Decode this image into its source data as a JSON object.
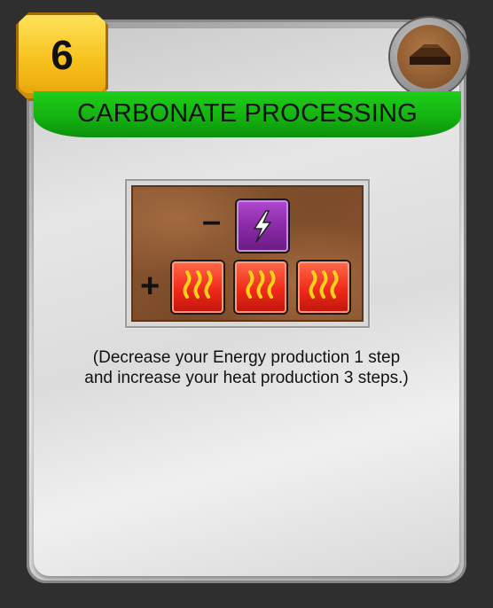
{
  "card": {
    "cost": "6",
    "title": "CARBONATE PROCESSING",
    "tag_icon": "building-tag-icon",
    "description_line1": "(Decrease your Energy production 1 step",
    "description_line2": "and increase your heat production 3 steps.)"
  },
  "production_box": {
    "decrease_sign": "–",
    "increase_sign": "+",
    "decrease": [
      {
        "resource": "energy",
        "icon": "energy-bolt-icon",
        "count": 1
      }
    ],
    "increase": [
      {
        "resource": "heat",
        "icon": "heat-waves-icon",
        "count": 3
      }
    ]
  },
  "colors": {
    "banner": "#14b010",
    "cost_tile": "#f7c11d",
    "energy": "#8a2aa7",
    "heat": "#f02a1a",
    "production_bg": "#7a4927"
  }
}
